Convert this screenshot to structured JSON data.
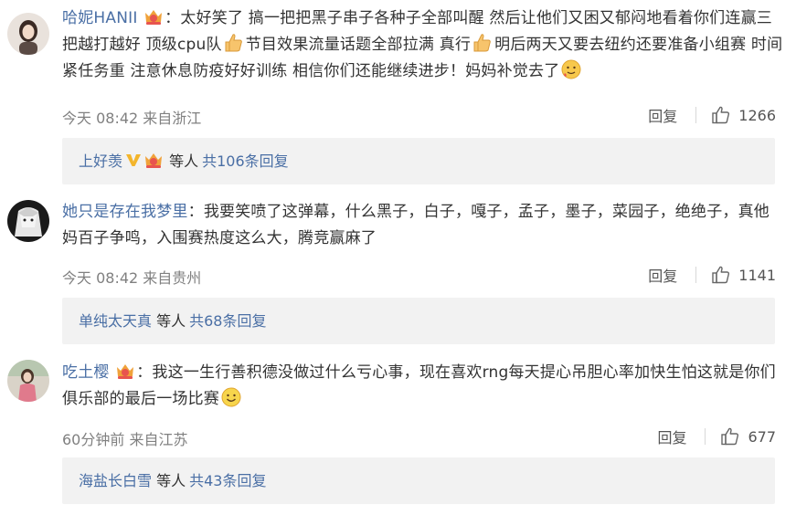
{
  "comments": [
    {
      "username": "哈妮HANII",
      "colon": "：",
      "text_parts": [
        "太好笑了 搞一把把黑子串子各种子全部叫醒 然后让他们又困又郁闷地看着你们连赢三把越打越好 顶级cpu队",
        "节目效果流量话题全部拉满 真行",
        "明后两天又要去纽约还要准备小组赛 时间紧任务重 注意休息防疫好好训练 相信你们还能继续进步！妈妈补觉去了"
      ],
      "time": "今天 08:42",
      "source": "来自浙江",
      "reply_label": "回复",
      "likes": "1266",
      "sub_user": "上好羡",
      "sub_etc": "等人",
      "sub_count": "共106条回复"
    },
    {
      "username": "她只是存在我梦里",
      "colon": "：",
      "text_parts": [
        "我要笑喷了这弹幕，什么黑子，白子，嘎子，孟子，墨子，菜园子，绝绝子，真他妈百子争鸣，入围赛热度这么大，腾竞赢麻了"
      ],
      "time": "今天 08:42",
      "source": "来自贵州",
      "reply_label": "回复",
      "likes": "1141",
      "sub_user": "单纯太天真",
      "sub_etc": "等人",
      "sub_count": "共68条回复"
    },
    {
      "username": "吃土樱",
      "colon": "：",
      "text_parts": [
        "我这一生行善积德没做过什么亏心事，现在喜欢rng每天提心吊胆心率加快生怕这就是你们俱乐部的最后一场比赛"
      ],
      "time": "60分钟前",
      "source": "来自江苏",
      "reply_label": "回复",
      "likes": "677",
      "sub_user": "海盐长白雪",
      "sub_etc": "等人",
      "sub_count": "共43条回复"
    }
  ],
  "colors": {
    "link": "#4a6fa5",
    "text": "#333333",
    "meta": "#808080",
    "subbox_bg": "#f2f2f2",
    "badge": "#e8544e"
  },
  "icons": {
    "badge": "fan-crown-badge-icon",
    "thumb": "thumbs-up-emoji-icon",
    "blush": "blush-emoji-icon",
    "smile": "smile-emoji-icon",
    "like": "like-thumb-icon",
    "verified": "verified-v-icon"
  }
}
